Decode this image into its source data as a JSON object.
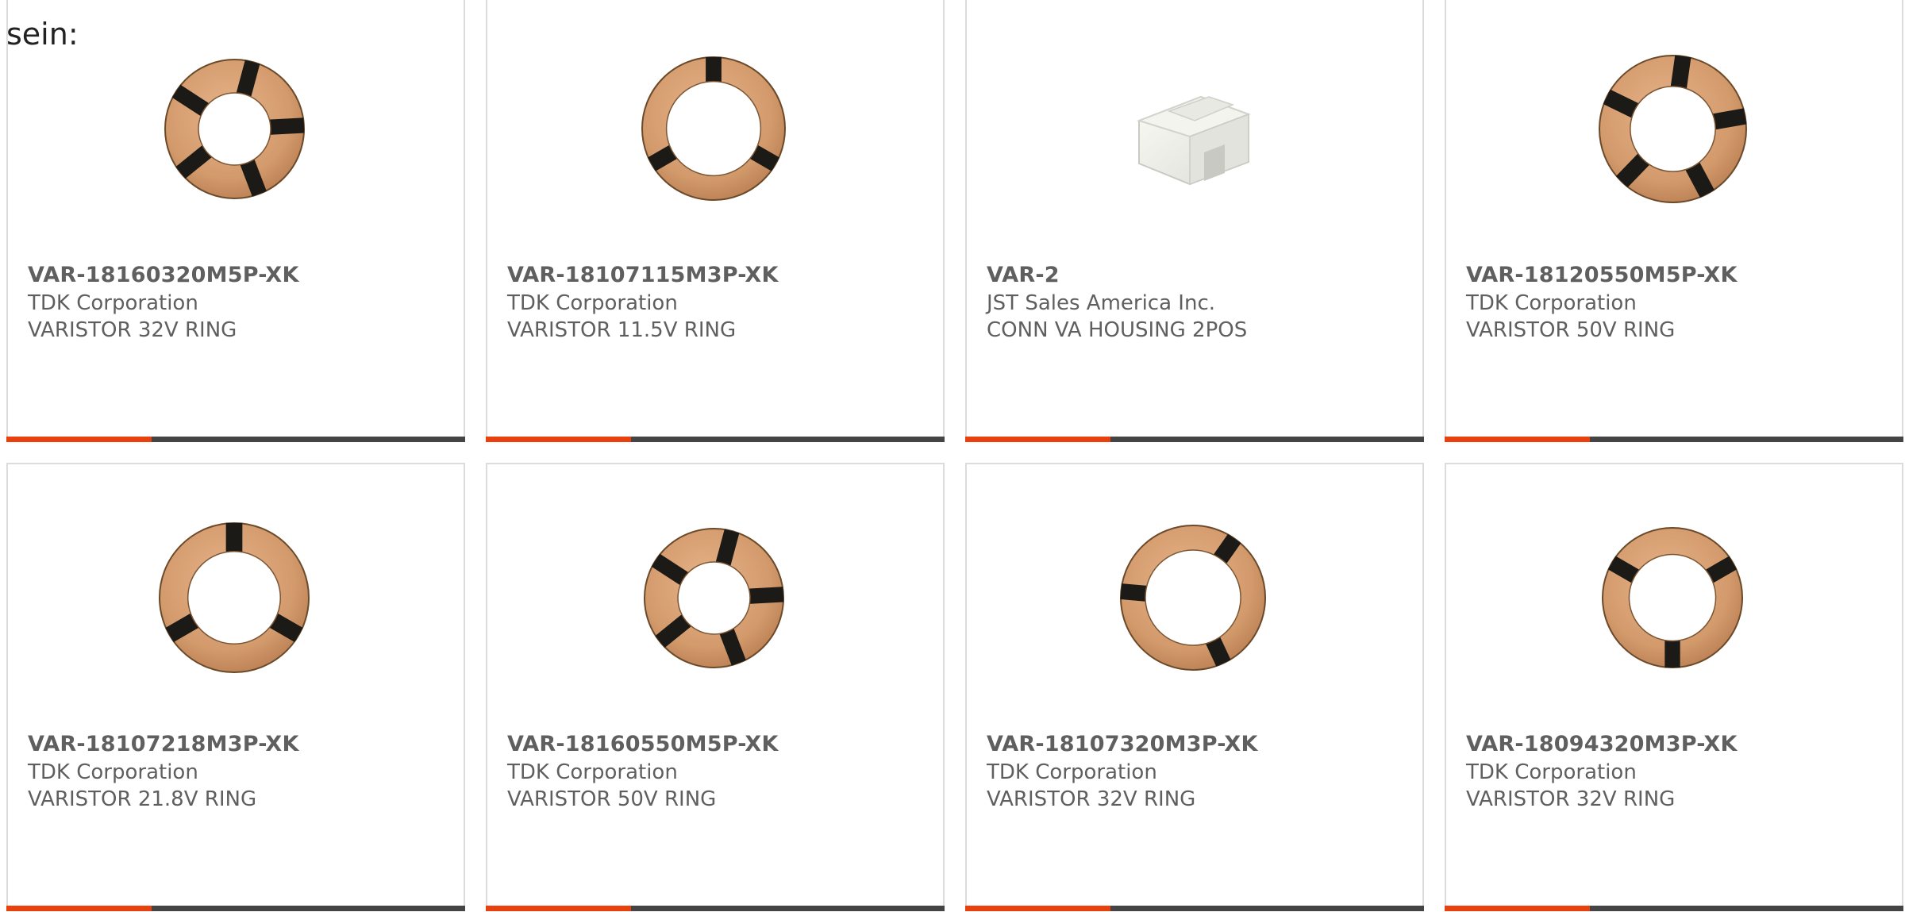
{
  "header": {
    "lead_text": "sein:"
  },
  "theme": {
    "accent_color": "#e8410e",
    "bar_color": "#444444",
    "text_color": "#5f5f5f"
  },
  "products": [
    {
      "part_number": "VAR-18160320M5P-XK",
      "manufacturer": "TDK Corporation",
      "description": "VARISTOR 32V RING",
      "image": "varistor-ring-5-segment-icon"
    },
    {
      "part_number": "VAR-18107115M3P-XK",
      "manufacturer": "TDK Corporation",
      "description": "VARISTOR 11.5V RING",
      "image": "varistor-ring-3-segment-icon"
    },
    {
      "part_number": "VAR-2",
      "manufacturer": "JST Sales America Inc.",
      "description": "CONN VA HOUSING 2POS",
      "image": "connector-housing-icon"
    },
    {
      "part_number": "VAR-18120550M5P-XK",
      "manufacturer": "TDK Corporation",
      "description": "VARISTOR 50V RING",
      "image": "varistor-ring-5-segment-icon"
    },
    {
      "part_number": "VAR-18107218M3P-XK",
      "manufacturer": "TDK Corporation",
      "description": "VARISTOR 21.8V RING",
      "image": "varistor-ring-3-segment-icon"
    },
    {
      "part_number": "VAR-18160550M5P-XK",
      "manufacturer": "TDK Corporation",
      "description": "VARISTOR 50V RING",
      "image": "varistor-ring-5-segment-icon"
    },
    {
      "part_number": "VAR-18107320M3P-XK",
      "manufacturer": "TDK Corporation",
      "description": "VARISTOR 32V RING",
      "image": "varistor-ring-3-segment-icon"
    },
    {
      "part_number": "VAR-18094320M3P-XK",
      "manufacturer": "TDK Corporation",
      "description": "VARISTOR 32V RING",
      "image": "varistor-ring-3-segment-icon"
    }
  ]
}
